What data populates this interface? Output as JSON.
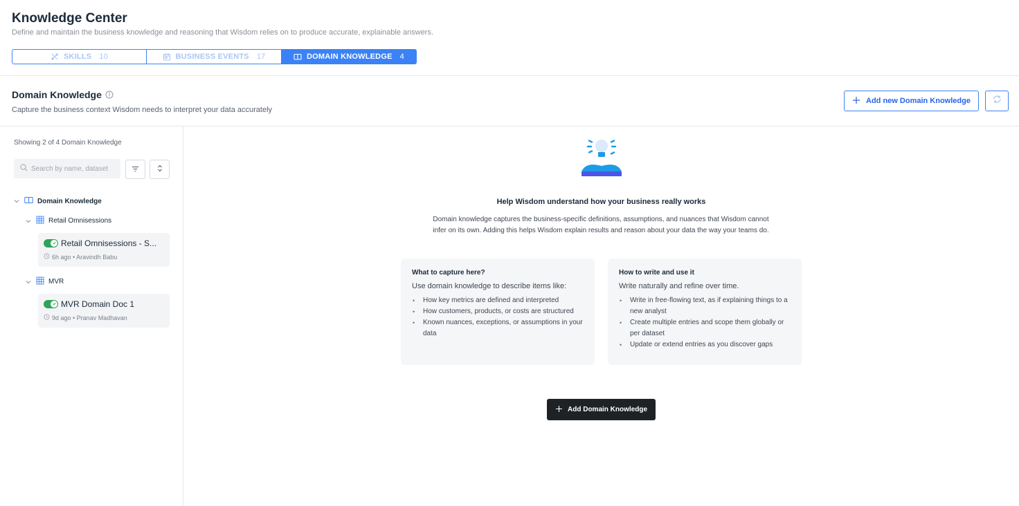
{
  "header": {
    "title": "Knowledge Center",
    "subtitle": "Define and maintain the business knowledge and reasoning that Wisdom relies on to produce accurate, explainable answers."
  },
  "tabs": [
    {
      "label": "SKILLS",
      "count": "10",
      "icon": "skills-icon",
      "active": false
    },
    {
      "label": "BUSINESS EVENTS",
      "count": "17",
      "icon": "calendar-icon",
      "active": false
    },
    {
      "label": "DOMAIN KNOWLEDGE",
      "count": "4",
      "icon": "book-icon",
      "active": true
    }
  ],
  "section": {
    "title": "Domain Knowledge",
    "description": "Capture the business context Wisdom needs to interpret your data accurately",
    "add_button_label": "Add new Domain Knowledge"
  },
  "sidebar": {
    "showing_text": "Showing 2 of 4 Domain Knowledge",
    "search_placeholder": "Search by name, dataset",
    "tree_root_label": "Domain Knowledge",
    "groups": [
      {
        "label": "Retail Omnisessions",
        "docs": [
          {
            "title": "Retail Omnisessions - S...",
            "meta": "6h ago • Aravindh Babu",
            "enabled": true
          }
        ]
      },
      {
        "label": "MVR",
        "docs": [
          {
            "title": "MVR Domain Doc 1",
            "meta": "9d ago • Pranav Madhavan",
            "enabled": true
          }
        ]
      }
    ]
  },
  "main": {
    "help_title": "Help Wisdom understand how your business really works",
    "help_description": "Domain knowledge captures the business-specific definitions, assumptions, and nuances that Wisdom cannot infer on its own. Adding this helps Wisdom explain results and reason about your data the way your teams do.",
    "cards": [
      {
        "title": "What to capture here?",
        "intro": "Use domain knowledge to describe items like:",
        "items": [
          "How key metrics are defined and interpreted",
          "How customers, products, or costs are structured",
          "Known nuances, exceptions, or assumptions in your data"
        ]
      },
      {
        "title": "How to write and use it",
        "intro": "Write naturally and refine over time.",
        "items": [
          "Write in free-flowing text, as if explaining things to a new analyst",
          "Create multiple entries and scope them globally or per dataset",
          "Update or extend entries as you discover gaps"
        ]
      }
    ],
    "add_button_label": "Add Domain Knowledge"
  },
  "colors": {
    "accent": "#3b82f6",
    "toggle_on": "#2fa35a",
    "dark_button": "#1f2225"
  }
}
